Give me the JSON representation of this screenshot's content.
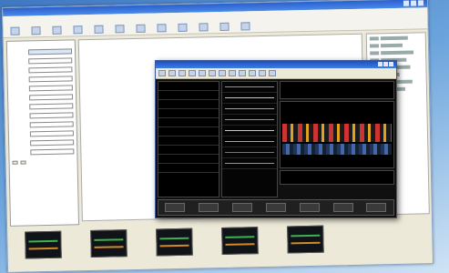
{
  "main_window": {
    "title": "",
    "toolbar": []
  },
  "left_panel": {
    "title": "",
    "fields": [],
    "buttons": []
  },
  "document": {
    "header": [],
    "lines": []
  },
  "status": {
    "text": ""
  },
  "thumbnails": [
    {
      "caption": ""
    },
    {
      "caption": ""
    },
    {
      "caption": ""
    },
    {
      "caption": ""
    },
    {
      "caption": ""
    }
  ],
  "monitor_window": {
    "title": "",
    "readouts": [
      "",
      "",
      "",
      "",
      ""
    ],
    "bottom_values": [
      "",
      "",
      "",
      "",
      ""
    ]
  },
  "colors": {
    "titlebar": "#2a5fcf",
    "monitor_bg": "#101010",
    "wave_green": "#3fcf4f",
    "wave_yellow": "#e6d14b",
    "wave_cyan": "#3fc8d8",
    "doppler_red": "#cc3333"
  }
}
